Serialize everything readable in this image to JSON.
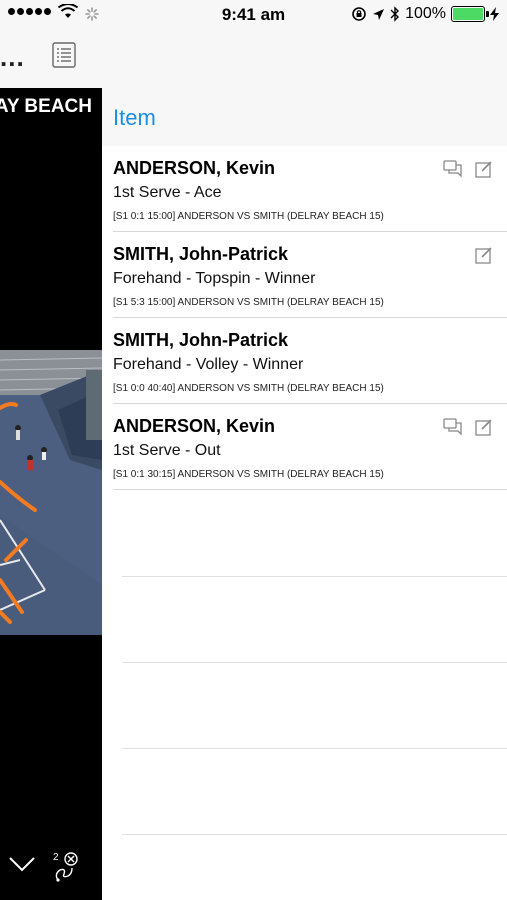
{
  "status_bar": {
    "time": "9:41 am",
    "battery_percent": "100%",
    "battery_level": 1.0
  },
  "left_panel": {
    "back_label": "...",
    "banner_text": "AY BEACH",
    "icons": [
      "list-icon",
      "chevron-down-icon",
      "draw-tool-icon"
    ]
  },
  "header": {
    "title": "Item"
  },
  "items": [
    {
      "name": "ANDERSON, Kevin",
      "action": "1st Serve - Ace",
      "meta": "[S1 0:1 15:00] ANDERSON VS SMITH (DELRAY BEACH 15)",
      "icons": [
        "comment-icon",
        "edit-icon"
      ]
    },
    {
      "name": "SMITH, John-Patrick",
      "action": "Forehand - Topspin - Winner",
      "meta": "[S1 5:3 15:00] ANDERSON VS SMITH (DELRAY BEACH 15)",
      "icons": [
        "edit-icon"
      ]
    },
    {
      "name": "SMITH, John-Patrick",
      "action": "Forehand - Volley - Winner",
      "meta": "[S1 0:0 40:40] ANDERSON VS SMITH (DELRAY BEACH 15)",
      "icons": []
    },
    {
      "name": "ANDERSON, Kevin",
      "action": "1st Serve - Out",
      "meta": "[S1 0:1 30:15] ANDERSON VS SMITH (DELRAY BEACH 15)",
      "icons": [
        "comment-icon",
        "edit-icon"
      ]
    }
  ]
}
